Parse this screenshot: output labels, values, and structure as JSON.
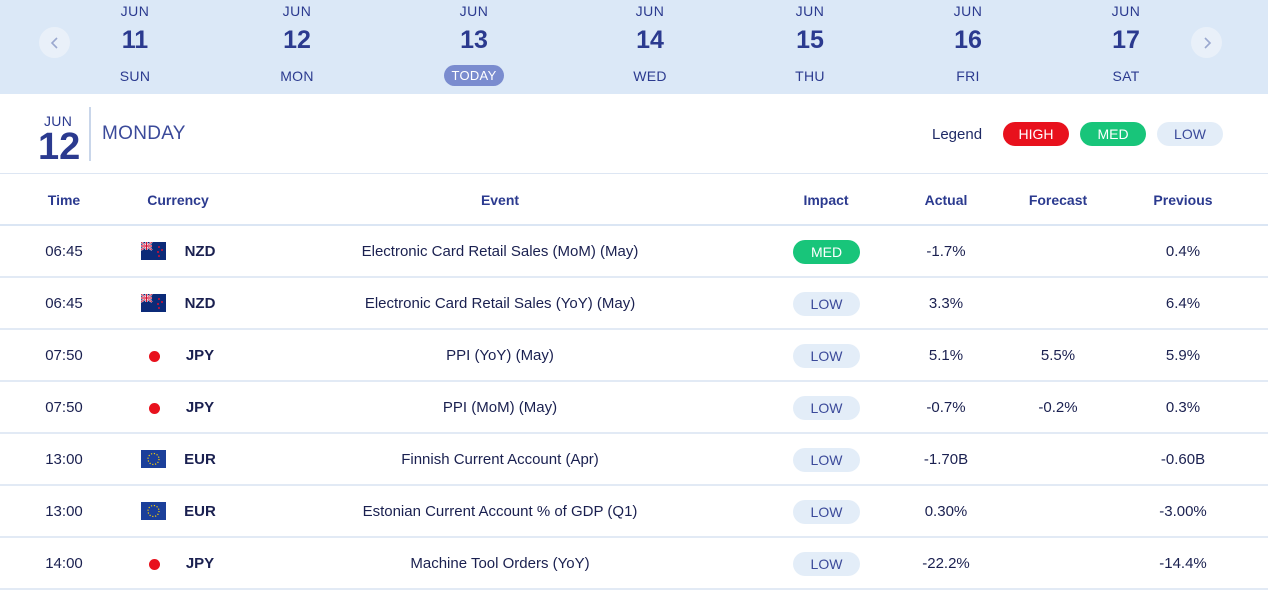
{
  "date_strip": {
    "days": [
      {
        "month": "JUN",
        "day": "11",
        "weekday": "SUN",
        "today": false
      },
      {
        "month": "JUN",
        "day": "12",
        "weekday": "MON",
        "today": false
      },
      {
        "month": "JUN",
        "day": "13",
        "weekday": "TODAY",
        "today": true
      },
      {
        "month": "JUN",
        "day": "14",
        "weekday": "WED",
        "today": false
      },
      {
        "month": "JUN",
        "day": "15",
        "weekday": "THU",
        "today": false
      },
      {
        "month": "JUN",
        "day": "16",
        "weekday": "FRI",
        "today": false
      },
      {
        "month": "JUN",
        "day": "17",
        "weekday": "SAT",
        "today": false
      }
    ],
    "prev_icon": "chevron-left-icon",
    "next_icon": "chevron-right-icon"
  },
  "day_header": {
    "month": "JUN",
    "day": "12",
    "weekday": "MONDAY"
  },
  "legend": {
    "label": "Legend",
    "high": "HIGH",
    "med": "MED",
    "low": "LOW"
  },
  "table": {
    "headers": {
      "time": "Time",
      "currency": "Currency",
      "event": "Event",
      "impact": "Impact",
      "actual": "Actual",
      "forecast": "Forecast",
      "previous": "Previous"
    },
    "rows": [
      {
        "time": "06:45",
        "flag": "new-zealand-flag-icon",
        "currency": "NZD",
        "event": "Electronic Card Retail Sales (MoM) (May)",
        "impact": "MED",
        "actual": "-1.7%",
        "forecast": "",
        "previous": "0.4%"
      },
      {
        "time": "06:45",
        "flag": "new-zealand-flag-icon",
        "currency": "NZD",
        "event": "Electronic Card Retail Sales (YoY) (May)",
        "impact": "LOW",
        "actual": "3.3%",
        "forecast": "",
        "previous": "6.4%"
      },
      {
        "time": "07:50",
        "flag": "japan-flag-icon",
        "currency": "JPY",
        "event": "PPI (YoY) (May)",
        "impact": "LOW",
        "actual": "5.1%",
        "forecast": "5.5%",
        "previous": "5.9%"
      },
      {
        "time": "07:50",
        "flag": "japan-flag-icon",
        "currency": "JPY",
        "event": "PPI (MoM) (May)",
        "impact": "LOW",
        "actual": "-0.7%",
        "forecast": "-0.2%",
        "previous": "0.3%"
      },
      {
        "time": "13:00",
        "flag": "eu-flag-icon",
        "currency": "EUR",
        "event": "Finnish Current Account (Apr)",
        "impact": "LOW",
        "actual": "-1.70B",
        "forecast": "",
        "previous": "-0.60B"
      },
      {
        "time": "13:00",
        "flag": "eu-flag-icon",
        "currency": "EUR",
        "event": "Estonian Current Account % of GDP (Q1)",
        "impact": "LOW",
        "actual": "0.30%",
        "forecast": "",
        "previous": "-3.00%"
      },
      {
        "time": "14:00",
        "flag": "japan-flag-icon",
        "currency": "JPY",
        "event": "Machine Tool Orders (YoY)",
        "impact": "LOW",
        "actual": "-22.2%",
        "forecast": "",
        "previous": "-14.4%"
      }
    ]
  },
  "colors": {
    "strip_bg": "#dbe8f7",
    "accent": "#2b3a8f",
    "today_pill": "#7a8ccf",
    "high": "#e8111d",
    "med": "#18c57a",
    "low_bg": "#e3edf8"
  }
}
